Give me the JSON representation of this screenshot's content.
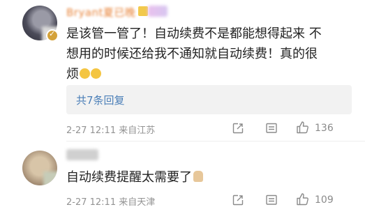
{
  "comments": [
    {
      "username": "Bryant夏已晚",
      "text_line1": "是该管一管了！自动续费不是都能想得起来 不",
      "text_line2": "想用的时候还给我不通知就自动续费！真的很",
      "text_line3": "烦",
      "replies_label": "共7条回复",
      "meta": "2-27 12:11  来自江苏",
      "likes": "136"
    },
    {
      "username": "",
      "text": "自动续费提醒太需要了",
      "meta": "2-27 12:11  来自天津",
      "likes": "109"
    }
  ]
}
